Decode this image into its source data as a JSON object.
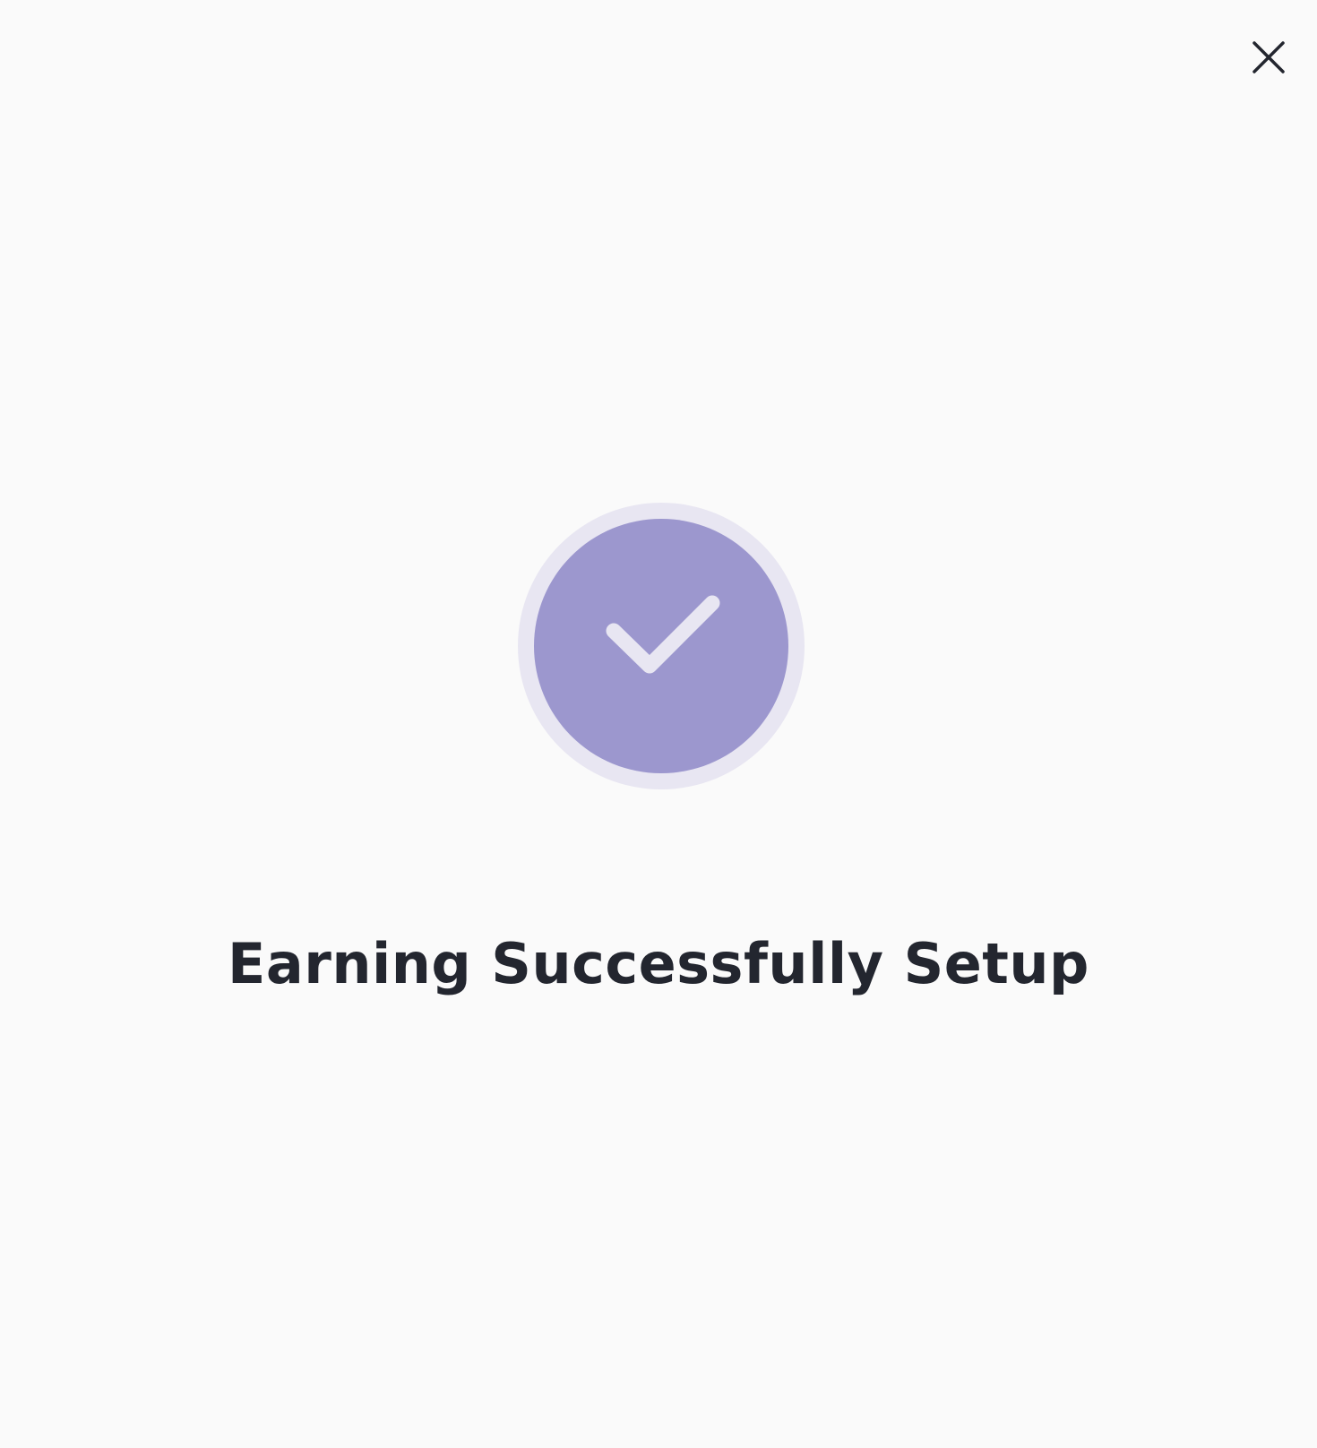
{
  "dialog": {
    "close_icon": "close-icon",
    "success_icon": "check-icon",
    "title": "Earning Successfully Setup"
  },
  "colors": {
    "background": "#fafafa",
    "badge_outer": "#e8e6f2",
    "badge_inner": "#9c97ce",
    "check": "#e8e6f2",
    "title_text": "#23262f",
    "close_icon": "#23262f"
  }
}
